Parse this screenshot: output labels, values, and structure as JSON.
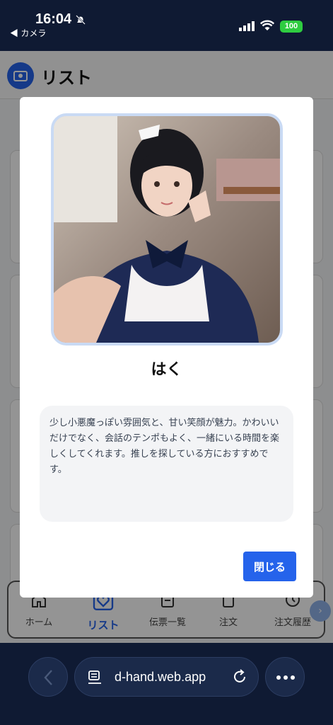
{
  "status": {
    "time": "16:04",
    "back_app": "◀ カメラ",
    "battery": "100"
  },
  "app": {
    "title": "リスト",
    "nav": [
      {
        "label": "ホーム",
        "icon": "home-icon"
      },
      {
        "label": "リスト",
        "icon": "heart-card-icon",
        "active": true
      },
      {
        "label": "伝票一覧",
        "icon": "receipt-icon"
      },
      {
        "label": "注文",
        "icon": "order-icon"
      },
      {
        "label": "注文履歴",
        "icon": "history-icon"
      }
    ]
  },
  "modal": {
    "name": "はく",
    "description": "少し小悪魔っぽい雰囲気と、甘い笑顔が魅力。かわいいだけでなく、会話のテンポもよく、一緒にいる時間を楽しくしてくれます。推しを探している方におすすめです。",
    "close_label": "閉じる"
  },
  "browser": {
    "url": "d-hand.web.app"
  },
  "colors": {
    "accent": "#2563eb",
    "photo_border": "#c9daf4",
    "status_bg": "#0f1a33"
  }
}
